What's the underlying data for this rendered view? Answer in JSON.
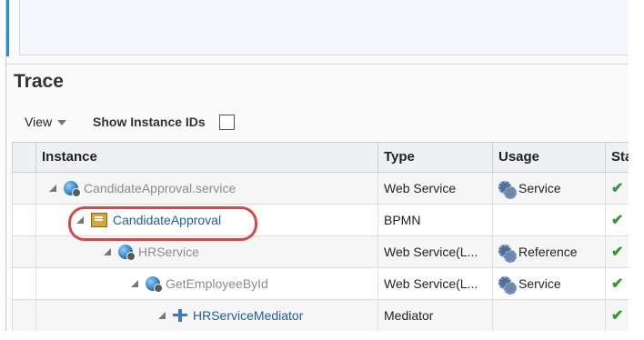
{
  "trace": {
    "title": "Trace",
    "toolbar": {
      "view_label": "View",
      "show_ids_label": "Show Instance IDs",
      "show_ids_checked": false
    },
    "columns": [
      "Instance",
      "Type",
      "Usage",
      "Sta"
    ],
    "rows": [
      {
        "instance": "CandidateApproval.service",
        "type": "Web Service",
        "usage": "Service",
        "usage_icon": "service-gear-icon",
        "icon": "web-service-globe-icon",
        "style": "muted",
        "level": 0,
        "status_icon": "green-check-icon"
      },
      {
        "instance": "CandidateApproval",
        "type": "BPMN",
        "usage": "",
        "usage_icon": "",
        "icon": "bpmn-process-icon",
        "style": "link",
        "level": 1,
        "status_icon": "green-check-icon",
        "highlighted": true
      },
      {
        "instance": "HRService",
        "type": "Web Service(L...",
        "usage": "Reference",
        "usage_icon": "reference-gear-icon",
        "icon": "web-service-globe-icon",
        "style": "muted",
        "level": 2,
        "status_icon": "green-check-icon"
      },
      {
        "instance": "GetEmployeeById",
        "type": "Web Service(L...",
        "usage": "Service",
        "usage_icon": "service-gear-icon",
        "icon": "web-service-globe-icon",
        "style": "muted",
        "level": 3,
        "status_icon": "green-check-icon"
      },
      {
        "instance": "HRServiceMediator",
        "type": "Mediator",
        "usage": "",
        "usage_icon": "",
        "icon": "mediator-icon",
        "style": "link",
        "level": 4,
        "status_icon": "green-check-icon"
      }
    ]
  },
  "colors": {
    "accent": "#1f8fd6",
    "link": "#1b5fa8",
    "highlight": "#d94848",
    "status_ok": "#2e9b2e"
  }
}
